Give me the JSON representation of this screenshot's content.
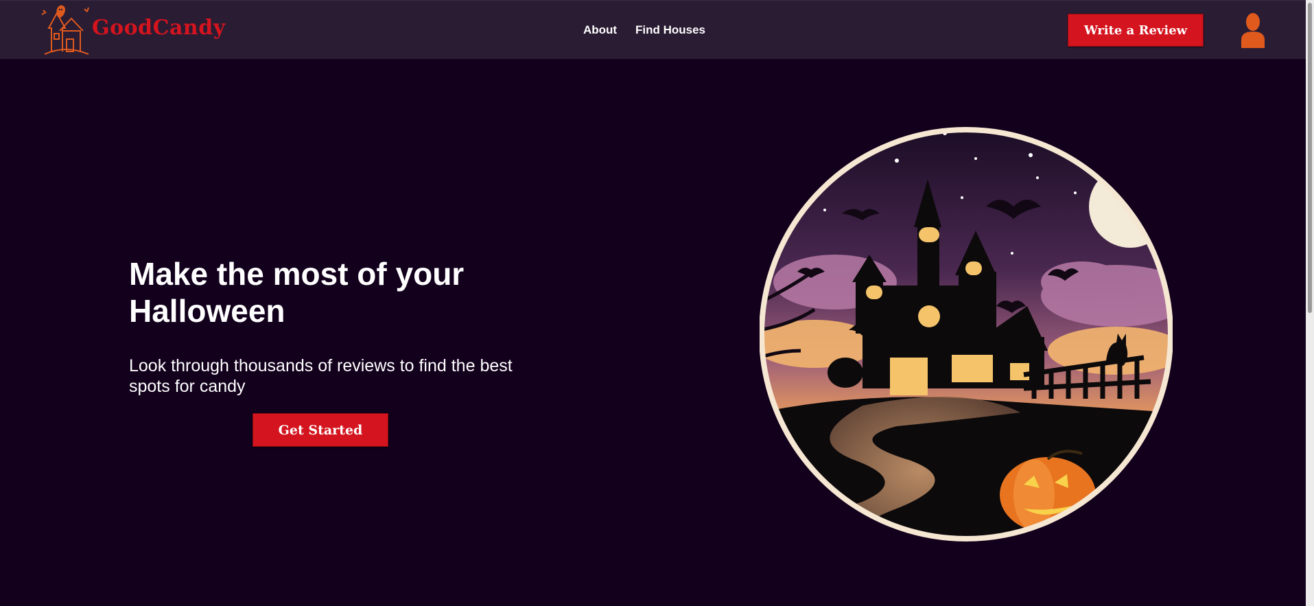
{
  "brand": {
    "name": "GoodCandy",
    "logo_icon": "haunted-house-ghost-icon",
    "color": "#d4141e"
  },
  "nav": {
    "links": [
      {
        "label": "About"
      },
      {
        "label": "Find Houses"
      }
    ]
  },
  "header": {
    "review_button_label": "Write a Review",
    "avatar_icon": "user-avatar-icon",
    "avatar_color": "#e05a1e"
  },
  "hero": {
    "title": "Make the most of your Halloween",
    "subtitle": "Look through thousands of reviews to find the best spots for candy",
    "cta_label": "Get Started",
    "image": "haunted-house-halloween-illustration"
  },
  "colors": {
    "background": "#12001c",
    "navbar": "#2a1c33",
    "accent": "#d4141e"
  }
}
